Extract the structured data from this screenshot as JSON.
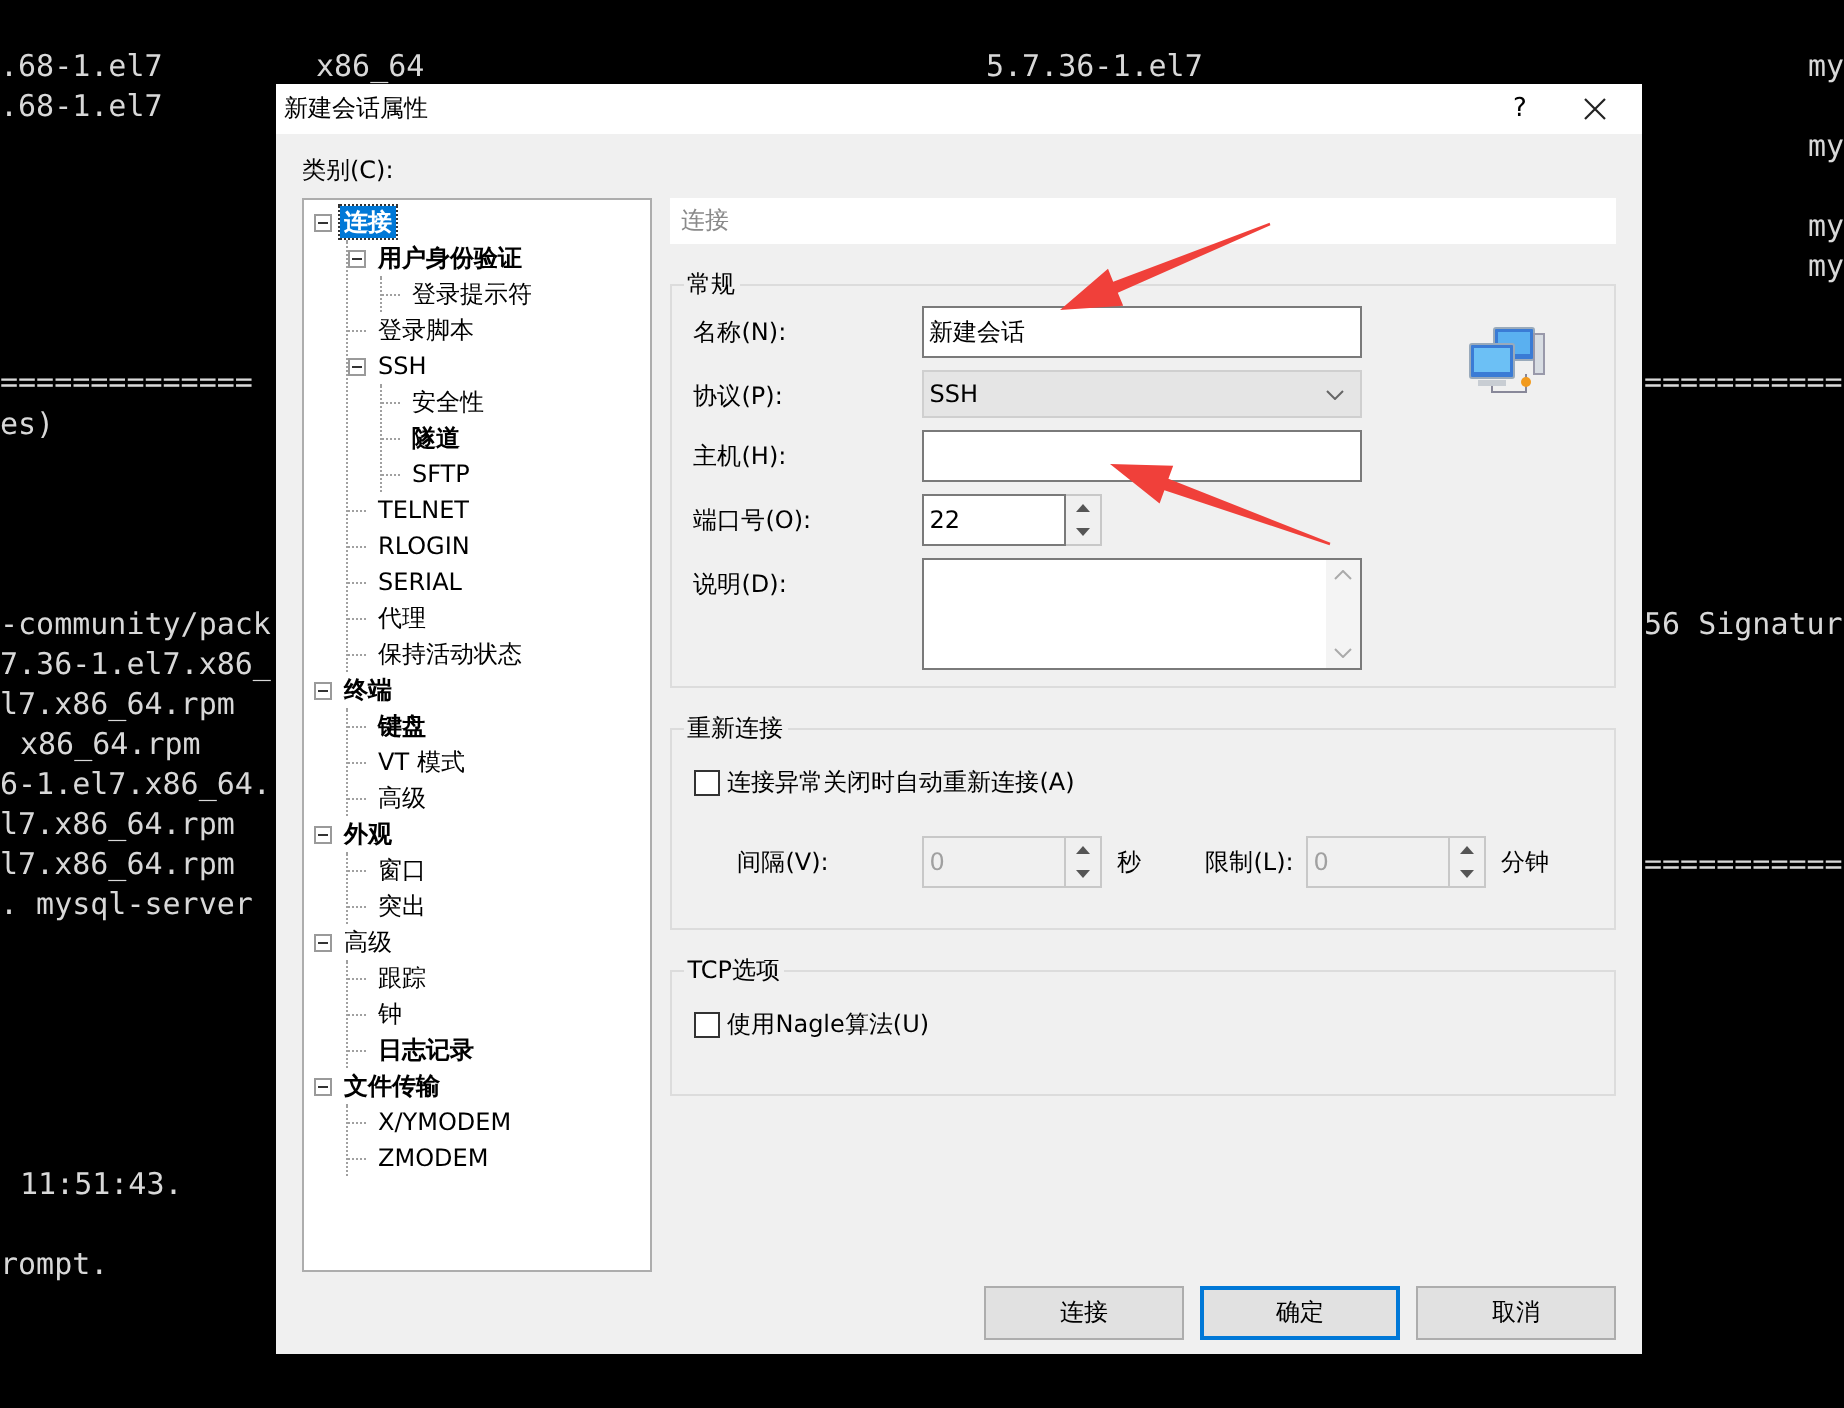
{
  "terminal": {
    "left_lines": [
      ".68-1.el7",
      ".68-1.el7",
      "==============",
      "es)",
      "-community/pack",
      "7.36-1.el7.x86_",
      "l7.x86_64.rpm",
      "x86_64.rpm",
      "6-1.el7.x86_64.",
      "l7.x86_64.rpm",
      "l7.x86_64.rpm",
      ". mysql-server",
      "11:51:43.",
      "rompt."
    ],
    "top_lines": [
      "x86_64",
      "5.7.36-1.el7"
    ],
    "right_lines": [
      "my",
      "my",
      "my",
      "my",
      "===========",
      "56 Signatur",
      "==========="
    ]
  },
  "dialog": {
    "title": "新建会话属性",
    "help": "?",
    "category_label": "类别(C):",
    "tree": [
      {
        "label": "连接",
        "bold": true,
        "selected": true,
        "expanded": true,
        "children": [
          {
            "label": "用户身份验证",
            "bold": true,
            "selected": false,
            "expanded": true,
            "children": [
              {
                "label": "登录提示符",
                "bold": false,
                "selected": false
              }
            ]
          },
          {
            "label": "登录脚本",
            "bold": false,
            "selected": false
          },
          {
            "label": "SSH",
            "bold": false,
            "selected": false,
            "expanded": true,
            "children": [
              {
                "label": "安全性",
                "bold": false,
                "selected": false
              },
              {
                "label": "隧道",
                "bold": true,
                "selected": false
              },
              {
                "label": "SFTP",
                "bold": false,
                "selected": false
              }
            ]
          },
          {
            "label": "TELNET",
            "bold": false,
            "selected": false
          },
          {
            "label": "RLOGIN",
            "bold": false,
            "selected": false
          },
          {
            "label": "SERIAL",
            "bold": false,
            "selected": false
          },
          {
            "label": "代理",
            "bold": false,
            "selected": false
          },
          {
            "label": "保持活动状态",
            "bold": false,
            "selected": false
          }
        ]
      },
      {
        "label": "终端",
        "bold": true,
        "selected": false,
        "expanded": true,
        "children": [
          {
            "label": "键盘",
            "bold": true,
            "selected": false
          },
          {
            "label": "VT 模式",
            "bold": false,
            "selected": false
          },
          {
            "label": "高级",
            "bold": false,
            "selected": false
          }
        ]
      },
      {
        "label": "外观",
        "bold": true,
        "selected": false,
        "expanded": true,
        "children": [
          {
            "label": "窗口",
            "bold": false,
            "selected": false
          },
          {
            "label": "突出",
            "bold": false,
            "selected": false
          }
        ]
      },
      {
        "label": "高级",
        "bold": false,
        "selected": false,
        "expanded": true,
        "children": [
          {
            "label": "跟踪",
            "bold": false,
            "selected": false
          },
          {
            "label": "钟",
            "bold": false,
            "selected": false
          },
          {
            "label": "日志记录",
            "bold": true,
            "selected": false
          }
        ]
      },
      {
        "label": "文件传输",
        "bold": true,
        "selected": false,
        "expanded": true,
        "children": [
          {
            "label": "X/YMODEM",
            "bold": false,
            "selected": false
          },
          {
            "label": "ZMODEM",
            "bold": false,
            "selected": false
          }
        ]
      }
    ],
    "panel_header": "连接",
    "general": {
      "legend": "常规",
      "fields": [
        {
          "kind": "text",
          "label": "名称(N):",
          "value": "新建会话"
        },
        {
          "kind": "dropdown",
          "label": "协议(P):",
          "value": "SSH"
        },
        {
          "kind": "text",
          "label": "主机(H):"
        },
        {
          "kind": "spinner",
          "label": "端口号(O):",
          "value": "22"
        },
        {
          "kind": "textarea",
          "label": "说明(D):"
        }
      ]
    },
    "reconnect": {
      "legend": "重新连接",
      "checkbox": {
        "label": "连接异常关闭时自动重新连接(A)",
        "checked": false
      },
      "spinners": [
        {
          "label": "间隔(V):",
          "value": "0",
          "unit": "秒",
          "disabled": true
        },
        {
          "label": "限制(L):",
          "value": "0",
          "unit": "分钟",
          "disabled": true
        }
      ]
    },
    "tcp": {
      "legend": "TCP选项",
      "checkbox": {
        "label": "使用Nagle算法(U)",
        "checked": false
      }
    },
    "buttons": [
      {
        "label": "连接",
        "default": false
      },
      {
        "label": "确定",
        "default": true
      },
      {
        "label": "取消",
        "default": false
      }
    ]
  }
}
